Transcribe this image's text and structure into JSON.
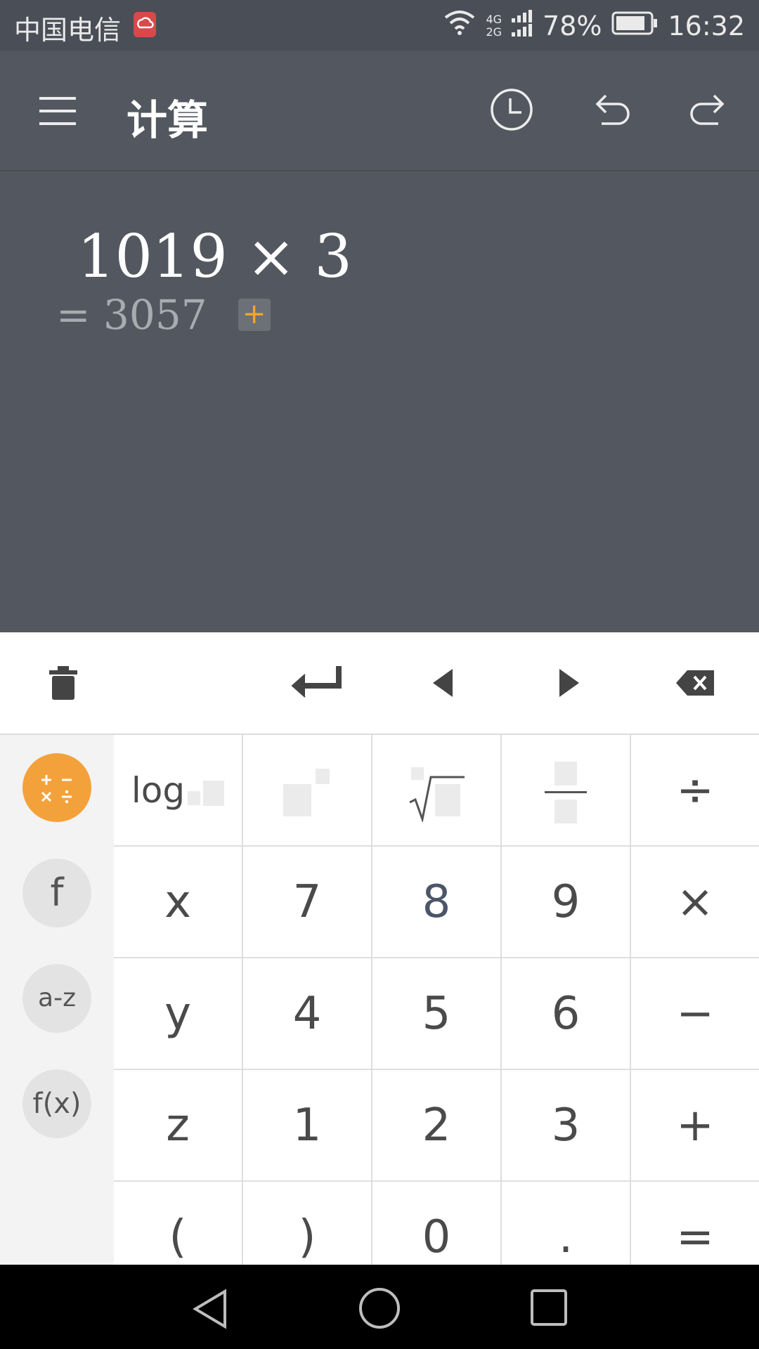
{
  "status_bar": {
    "carrier": "中国电信",
    "network_top": "4G",
    "network_bottom": "2G",
    "battery": "78%",
    "time": "16:32"
  },
  "app_bar": {
    "title": "计算",
    "icons": [
      "menu-icon",
      "history-clock-icon",
      "undo-icon",
      "redo-icon"
    ]
  },
  "display": {
    "expression": "1019 × 3",
    "result": "= 3057",
    "add_label": "+"
  },
  "toolbar": {
    "icons": [
      "trash-icon",
      "enter-icon",
      "cursor-left-icon",
      "cursor-right-icon",
      "backspace-icon"
    ]
  },
  "keypad": {
    "side": [
      {
        "label": "",
        "icon": "arithmetic-operators-icon",
        "active": true
      },
      {
        "label": "f",
        "icon": "function-icon"
      },
      {
        "label": "a-z",
        "icon": "letters-icon"
      },
      {
        "label": "f(x)",
        "icon": "function-of-x-icon"
      }
    ],
    "row1": {
      "log": "log",
      "divide": "÷"
    },
    "row2": [
      "x",
      "7",
      "8",
      "9",
      "×"
    ],
    "row3": [
      "y",
      "4",
      "5",
      "6",
      "−"
    ],
    "row4": [
      "z",
      "1",
      "2",
      "3",
      "+"
    ],
    "row5": [
      "(",
      ")",
      "0",
      ".",
      "="
    ]
  },
  "colors": {
    "accent": "#f3a23b",
    "header_bg": "#535860",
    "add_plus": "#f3a62a"
  }
}
